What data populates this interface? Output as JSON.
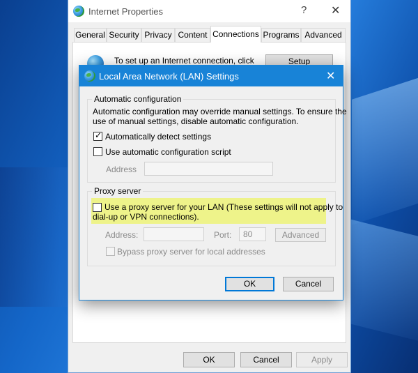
{
  "back_window": {
    "title": "Internet Properties",
    "help_glyph": "?",
    "close_glyph": "✕",
    "tabs": [
      {
        "label": "General",
        "active": false
      },
      {
        "label": "Security",
        "active": false
      },
      {
        "label": "Privacy",
        "active": false
      },
      {
        "label": "Content",
        "active": false
      },
      {
        "label": "Connections",
        "active": true
      },
      {
        "label": "Programs",
        "active": false
      },
      {
        "label": "Advanced",
        "active": false
      }
    ],
    "connection_text": "To set up an Internet connection, click",
    "setup_label": "Setup",
    "ok_label": "OK",
    "cancel_label": "Cancel",
    "apply_label": "Apply"
  },
  "lan_dialog": {
    "title": "Local Area Network (LAN) Settings",
    "close_glyph": "✕",
    "auto_config": {
      "legend": "Automatic configuration",
      "description_line1": "Automatic configuration may override manual settings.  To ensure the",
      "description_line2": "use of manual settings, disable automatic configuration.",
      "detect_label": "Automatically detect settings",
      "detect_checked": true,
      "script_label": "Use automatic configuration script",
      "script_checked": false,
      "address_label": "Address",
      "address_value": ""
    },
    "proxy": {
      "legend": "Proxy server",
      "use_proxy_line1": "Use a proxy server for your LAN (These settings will not apply to",
      "use_proxy_line2": "dial-up or VPN connections).",
      "use_proxy_checked": false,
      "address_label": "Address:",
      "address_value": "",
      "port_label": "Port:",
      "port_value": "80",
      "advanced_label": "Advanced",
      "bypass_label": "Bypass proxy server for local addresses",
      "bypass_checked": false
    },
    "ok_label": "OK",
    "cancel_label": "Cancel",
    "check_glyph": "✓"
  },
  "colors": {
    "accent": "#1883d7",
    "highlight": "#eef38a"
  }
}
